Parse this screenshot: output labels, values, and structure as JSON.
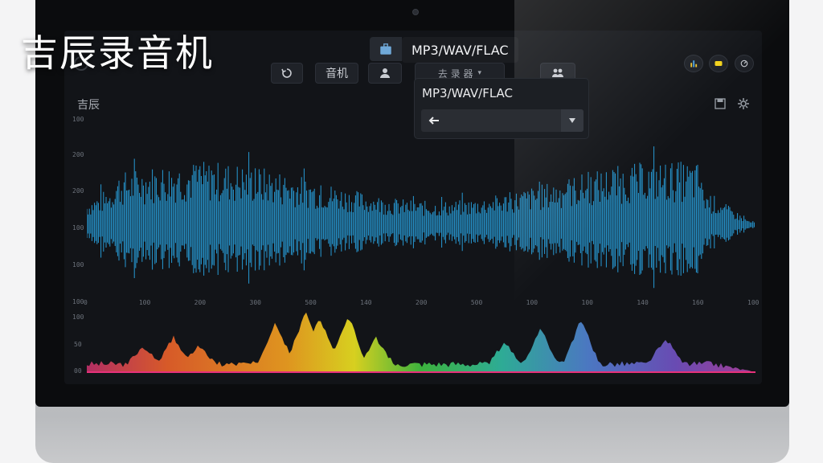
{
  "app": {
    "title": "吉辰录音机"
  },
  "toolbar": {
    "record_label": "音机",
    "source_label": "去 录 器",
    "format_label": "MP3/WAV/FLAC"
  },
  "dropdown": {
    "title": "MP3/WAV/FLAC"
  },
  "waveform_panel": {
    "title": "吉辰",
    "y_labels": [
      "100",
      "200",
      "200",
      "100",
      "100",
      "100"
    ],
    "x_labels": [
      "0",
      "100",
      "200",
      "300",
      "500",
      "140",
      "200",
      "500",
      "100",
      "100",
      "140",
      "160",
      "100"
    ]
  },
  "spectrum_panel": {
    "y_labels": [
      "100",
      "50",
      "00"
    ]
  },
  "colors": {
    "waveform": "#2aa8e8",
    "background": "#121418"
  }
}
